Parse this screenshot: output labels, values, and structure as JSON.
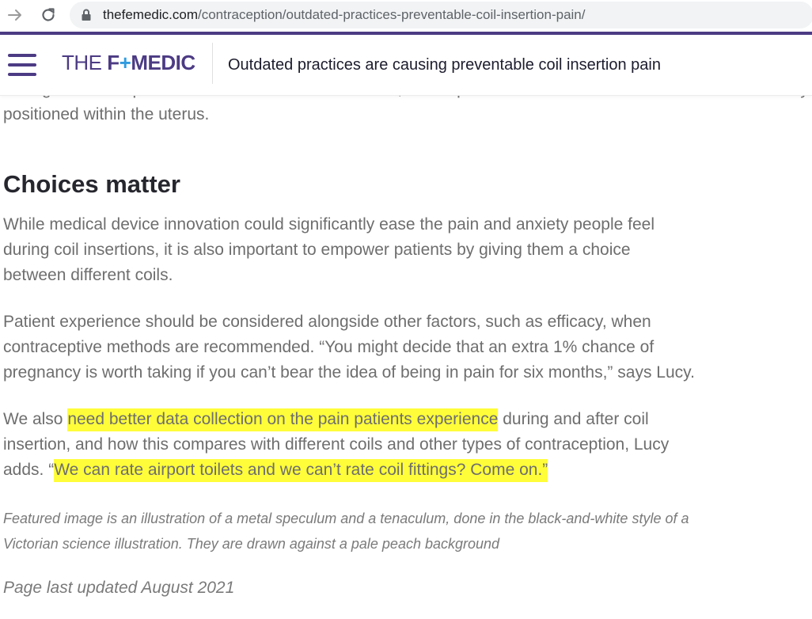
{
  "browser": {
    "url_domain": "thefemedic.com",
    "url_path": "/contraception/outdated-practices-preventable-coil-insertion-pain/"
  },
  "header": {
    "logo_the": "THE ",
    "logo_f": "F",
    "logo_cross": "+",
    "logo_rest": "MEDIC",
    "title": "Outdated practices are causing preventable coil insertion pain"
  },
  "article": {
    "cut_line_top": "distinguished the position of the uterus cervix and this, the help of ultrasound to make sure the coil is correctly",
    "cut_line_bottom": "positioned within the uterus.",
    "heading": "Choices matter",
    "para1": [
      "While medical device innovation could significantly ease the pain and anxiety people feel",
      "during coil insertions, it is also important to empower patients by giving them a choice",
      "between different coils."
    ],
    "para2": [
      "Patient experience should be considered alongside other factors, such as efficacy, when",
      "contraceptive methods are recommended. “You might decide that an extra 1% chance of",
      "pregnancy is worth taking if you can’t bear the idea of being in pain for six months,” says Lucy."
    ],
    "para3": {
      "l1_pre": "We also ",
      "l1_hl": "need better data collection on the pain patients experience",
      "l1_post": " during and after coil",
      "l2": "insertion, and how this compares with different coils and other types of contraception, Lucy",
      "l3_pre": "adds. “",
      "l3_hl": "We can rate airport toilets and we can’t rate coil fittings? Come on.”"
    },
    "caption": [
      "Featured image is an illustration of a metal speculum and a tenaculum, done in the black-and-white style of a",
      "Victorian science illustration. They are drawn against a pale peach background"
    ],
    "updated": "Page last updated August 2021"
  },
  "colors": {
    "brand": "#4c3b84",
    "highlight": "#fffd3a",
    "body_text": "#6e6e6e",
    "heading": "#26262e"
  },
  "icons": [
    "forward-arrow-icon",
    "reload-icon",
    "lock-icon",
    "hamburger-menu-icon"
  ]
}
